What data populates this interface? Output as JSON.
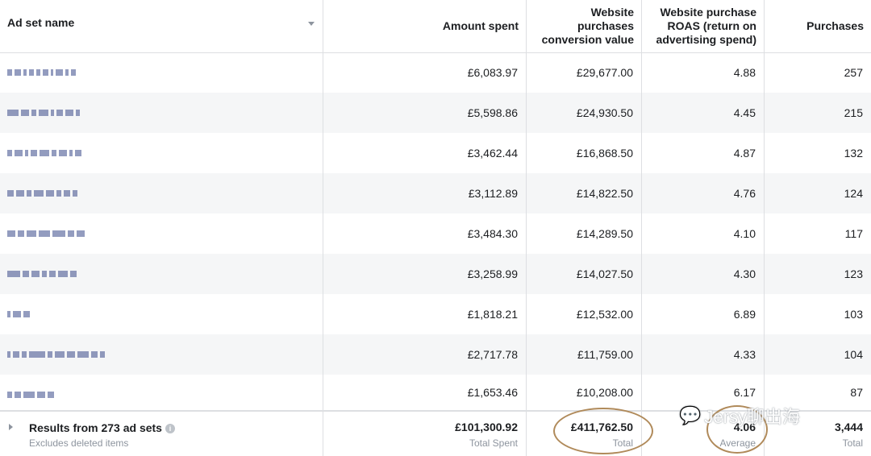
{
  "columns": {
    "name": "Ad set name",
    "amount": "Amount spent",
    "conv_value_l1": "Website",
    "conv_value_l2": "purchases",
    "conv_value_l3": "conversion value",
    "roas_l1": "Website purchase",
    "roas_l2": "ROAS (return on",
    "roas_l3": "advertising spend)",
    "purchases": "Purchases"
  },
  "rows": [
    {
      "amount": "£6,083.97",
      "conv_value": "£29,677.00",
      "roas": "4.88",
      "purchases": "257"
    },
    {
      "amount": "£5,598.86",
      "conv_value": "£24,930.50",
      "roas": "4.45",
      "purchases": "215"
    },
    {
      "amount": "£3,462.44",
      "conv_value": "£16,868.50",
      "roas": "4.87",
      "purchases": "132"
    },
    {
      "amount": "£3,112.89",
      "conv_value": "£14,822.50",
      "roas": "4.76",
      "purchases": "124"
    },
    {
      "amount": "£3,484.30",
      "conv_value": "£14,289.50",
      "roas": "4.10",
      "purchases": "117"
    },
    {
      "amount": "£3,258.99",
      "conv_value": "£14,027.50",
      "roas": "4.30",
      "purchases": "123"
    },
    {
      "amount": "£1,818.21",
      "conv_value": "£12,532.00",
      "roas": "6.89",
      "purchases": "103"
    },
    {
      "amount": "£2,717.78",
      "conv_value": "£11,759.00",
      "roas": "4.33",
      "purchases": "104"
    },
    {
      "amount": "£1,653.46",
      "conv_value": "£10,208.00",
      "roas": "6.17",
      "purchases": "87"
    }
  ],
  "footer": {
    "title": "Results from 273 ad sets",
    "subtitle": "Excludes deleted items",
    "amount": "£101,300.92",
    "amount_label": "Total Spent",
    "conv_value": "£411,762.50",
    "conv_value_label": "Total",
    "roas": "4.06",
    "roas_label": "Average",
    "purchases": "3,444",
    "purchases_label": "Total"
  },
  "watermark": "Jersy聊出海",
  "icons": {
    "sort": "chevron-down-icon",
    "expand": "chevron-right-icon",
    "info": "info-icon",
    "watermark": "wechat-icon"
  },
  "colors": {
    "annotation_circle": "#b08a5a",
    "alt_row": "#f5f6f7",
    "border": "#dddfe2"
  }
}
